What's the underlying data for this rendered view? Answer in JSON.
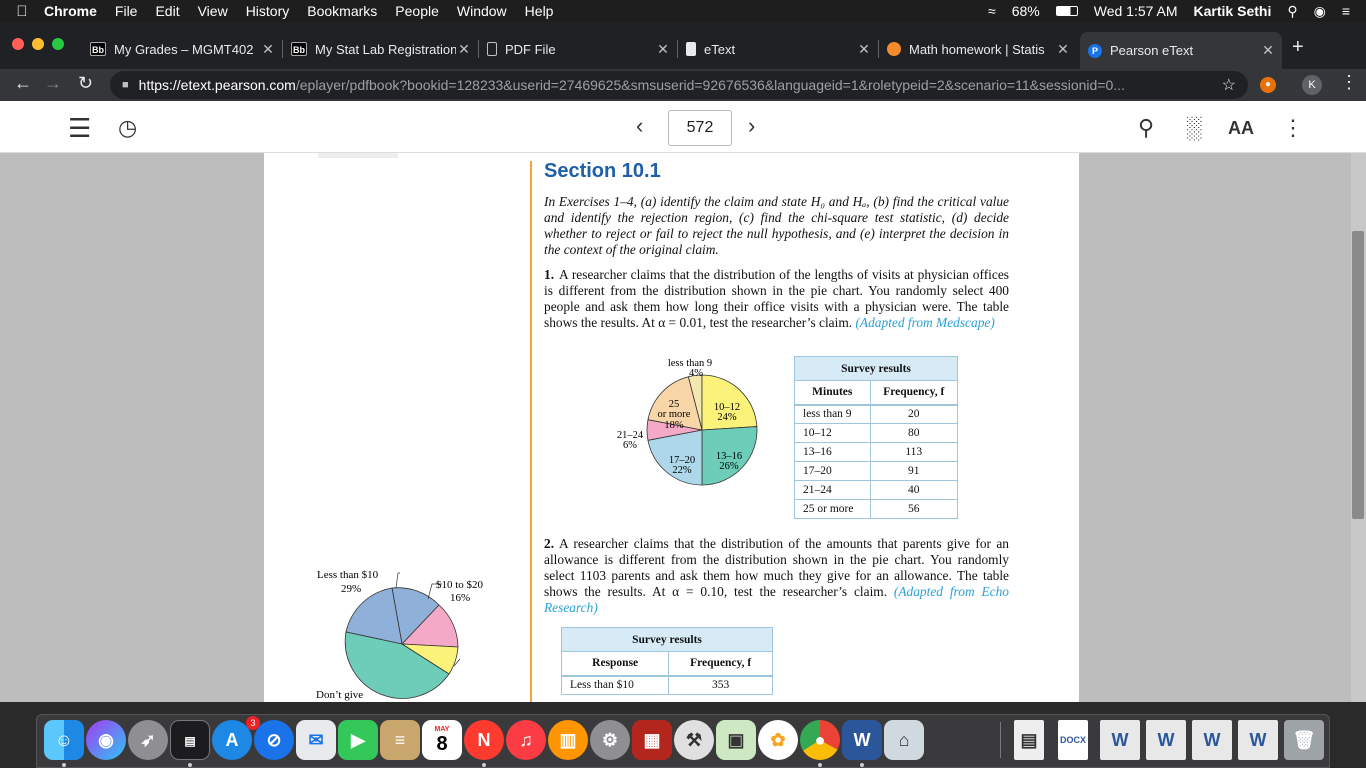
{
  "menubar": {
    "app": "Chrome",
    "items": [
      "File",
      "Edit",
      "View",
      "History",
      "Bookmarks",
      "People",
      "Window",
      "Help"
    ],
    "battery": "68%",
    "clock": "Wed 1:57 AM",
    "user": "Kartik Sethi"
  },
  "tabs": [
    {
      "icon": "Bb",
      "title": "My Grades – MGMT402"
    },
    {
      "icon": "Bb",
      "title": "My Stat Lab Registration"
    },
    {
      "icon": "doc",
      "title": "PDF File"
    },
    {
      "icon": "doc",
      "title": "eText"
    },
    {
      "icon": "statis",
      "title": "Math homework | Statis"
    },
    {
      "icon": "P",
      "title": "Pearson eText"
    }
  ],
  "address": {
    "host": "https://etext.pearson.com",
    "path": "/eplayer/pdfbook?bookid=128233&userid=27469625&smsuserid=92676536&languageid=1&roletypeid=2&scenario=11&sessionid=0..."
  },
  "profile_initial": "K",
  "reader": {
    "page_number": "572",
    "font_button": "AA"
  },
  "doc": {
    "section_title": "Section 10.1",
    "intro": "In Exercises 1–4, (a) identify the claim and state H₀ and Hₐ, (b) find the critical value and identify the rejection region, (c) find the chi-square test statistic, (d) decide whether to reject or fail to reject the null hypothesis, and (e) interpret the decision in the context of the original claim.",
    "ex1": {
      "num": "1.",
      "text": "A researcher claims that the distribution of the lengths of visits at physician offices is different from the distribution shown in the pie chart. You randomly select 400 people and ask them how long their office visits with a physician were. The table shows the results. At α = 0.01, test the researcher’s claim.",
      "source": "(Adapted from Medscape)",
      "pie": [
        {
          "label": "less than 9",
          "pct": "4%",
          "value": 4,
          "color": "#f3e9b0"
        },
        {
          "label": "10–12",
          "pct": "24%",
          "value": 24,
          "color": "#fbf27a"
        },
        {
          "label": "13–16",
          "pct": "26%",
          "value": 26,
          "color": "#6ecdb8"
        },
        {
          "label": "17–20",
          "pct": "22%",
          "value": 22,
          "color": "#aed8ea"
        },
        {
          "label": "21–24",
          "pct": "6%",
          "value": 6,
          "color": "#f4a9c6"
        },
        {
          "label": "25 or more",
          "pct": "18%",
          "value": 18,
          "color": "#f8d6a8"
        }
      ],
      "table": {
        "caption": "Survey results",
        "headers": [
          "Minutes",
          "Frequency, f"
        ],
        "rows": [
          [
            "less than 9",
            "20"
          ],
          [
            "10–12",
            "80"
          ],
          [
            "13–16",
            "113"
          ],
          [
            "17–20",
            "91"
          ],
          [
            "21–24",
            "40"
          ],
          [
            "25 or more",
            "56"
          ]
        ]
      }
    },
    "ex2": {
      "num": "2.",
      "text": "A researcher claims that the distribution of the amounts that parents give for an allowance is different from the distribution shown in the pie chart. You randomly select 1103 parents and ask them how much they give for an allowance. The table shows the results. At α = 0.10, test the researcher’s claim.",
      "source": "(Adapted from Echo Research)",
      "pie_labels": [
        {
          "label": "Less than $10",
          "pct": "29%"
        },
        {
          "label": "$10 to $20",
          "pct": "16%"
        },
        {
          "label": "Don’t give",
          "pct": ""
        }
      ],
      "table": {
        "caption": "Survey results",
        "headers": [
          "Response",
          "Frequency, f"
        ],
        "rows": [
          [
            "Less than $10",
            "353"
          ]
        ]
      }
    }
  },
  "dock": {
    "calendar_month": "MAY",
    "calendar_day": "8",
    "appstore_badge": "3",
    "items": [
      "finder",
      "siri",
      "launchpad",
      "activity-monitor",
      "app-store",
      "safari",
      "mail",
      "facetime",
      "notes",
      "calendar",
      "news",
      "music",
      "books",
      "system-preferences",
      "photo-booth",
      "xcode",
      "preview",
      "photos",
      "chrome",
      "word",
      "airdrop",
      "file",
      "docx",
      "word-doc-1",
      "word-doc-2",
      "word-doc-3",
      "word-doc-4",
      "trash"
    ]
  }
}
